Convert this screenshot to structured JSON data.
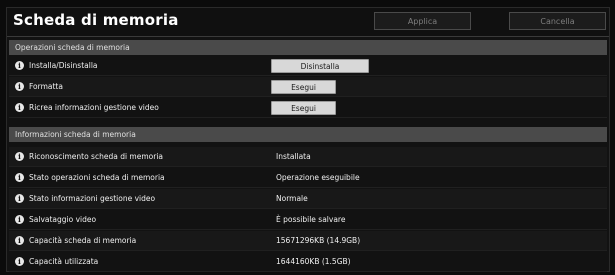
{
  "header": {
    "title": "Scheda di memoria",
    "apply_label": "Applica",
    "cancel_label": "Cancella"
  },
  "operations": {
    "section_title": "Operazioni scheda di memoria",
    "rows": [
      {
        "label": "Installa/Disinstalla",
        "button": "Disinstalla"
      },
      {
        "label": "Formatta",
        "button": "Esegui"
      },
      {
        "label": "Ricrea informazioni gestione video",
        "button": "Esegui"
      }
    ]
  },
  "information": {
    "section_title": "Informazioni scheda di memoria",
    "rows": [
      {
        "label": "Riconoscimento scheda di memoria",
        "value": "Installata"
      },
      {
        "label": "Stato operazioni scheda di memoria",
        "value": "Operazione eseguibile"
      },
      {
        "label": "Stato informazioni gestione video",
        "value": "Normale"
      },
      {
        "label": "Salvataggio video",
        "value": "È possibile salvare"
      },
      {
        "label": "Capacità scheda di memoria",
        "value": "15671296KB (14.9GB)"
      },
      {
        "label": "Capacità utilizzata",
        "value": "1644160KB (1.5GB)"
      }
    ]
  },
  "icons": {
    "info": "info-icon"
  }
}
